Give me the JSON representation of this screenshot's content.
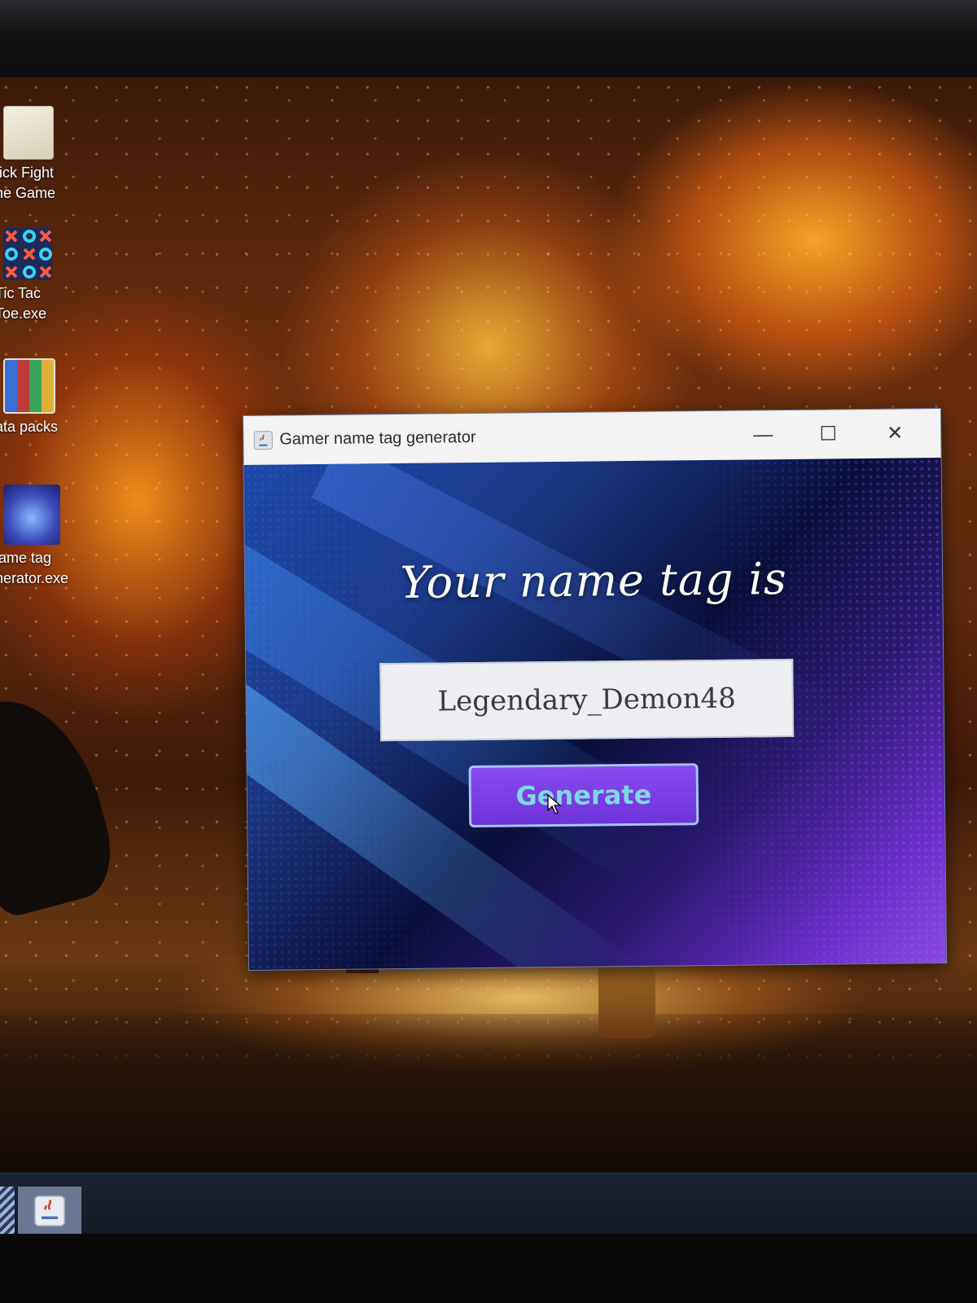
{
  "desktop": {
    "icons": [
      {
        "label_line1": "tick Fight",
        "label_line2": "he Game",
        "icon": "folder-icon"
      },
      {
        "label_line1": "Tic Tac",
        "label_line2": "Toe.exe",
        "icon": "tic-tac-toe-icon"
      },
      {
        "label_line1": "ata packs",
        "label_line2": "",
        "icon": "archive-icon"
      },
      {
        "label_line1": "lame tag",
        "label_line2": "nerator.exe",
        "icon": "gamepad-icon"
      }
    ]
  },
  "window": {
    "title": "Gamer name tag generator",
    "controls": {
      "minimize": "—",
      "maximize": "☐",
      "close": "✕"
    },
    "headline": "Your name tag is",
    "tag_value": "Legendary_Demon48",
    "generate_label": "Generate",
    "colors": {
      "button": "#7a3ee6",
      "button_text": "#7fd8e8",
      "field": "#eceef2"
    }
  },
  "taskbar": {
    "items": [
      {
        "icon": "app-icon"
      },
      {
        "icon": "java-icon"
      }
    ]
  }
}
